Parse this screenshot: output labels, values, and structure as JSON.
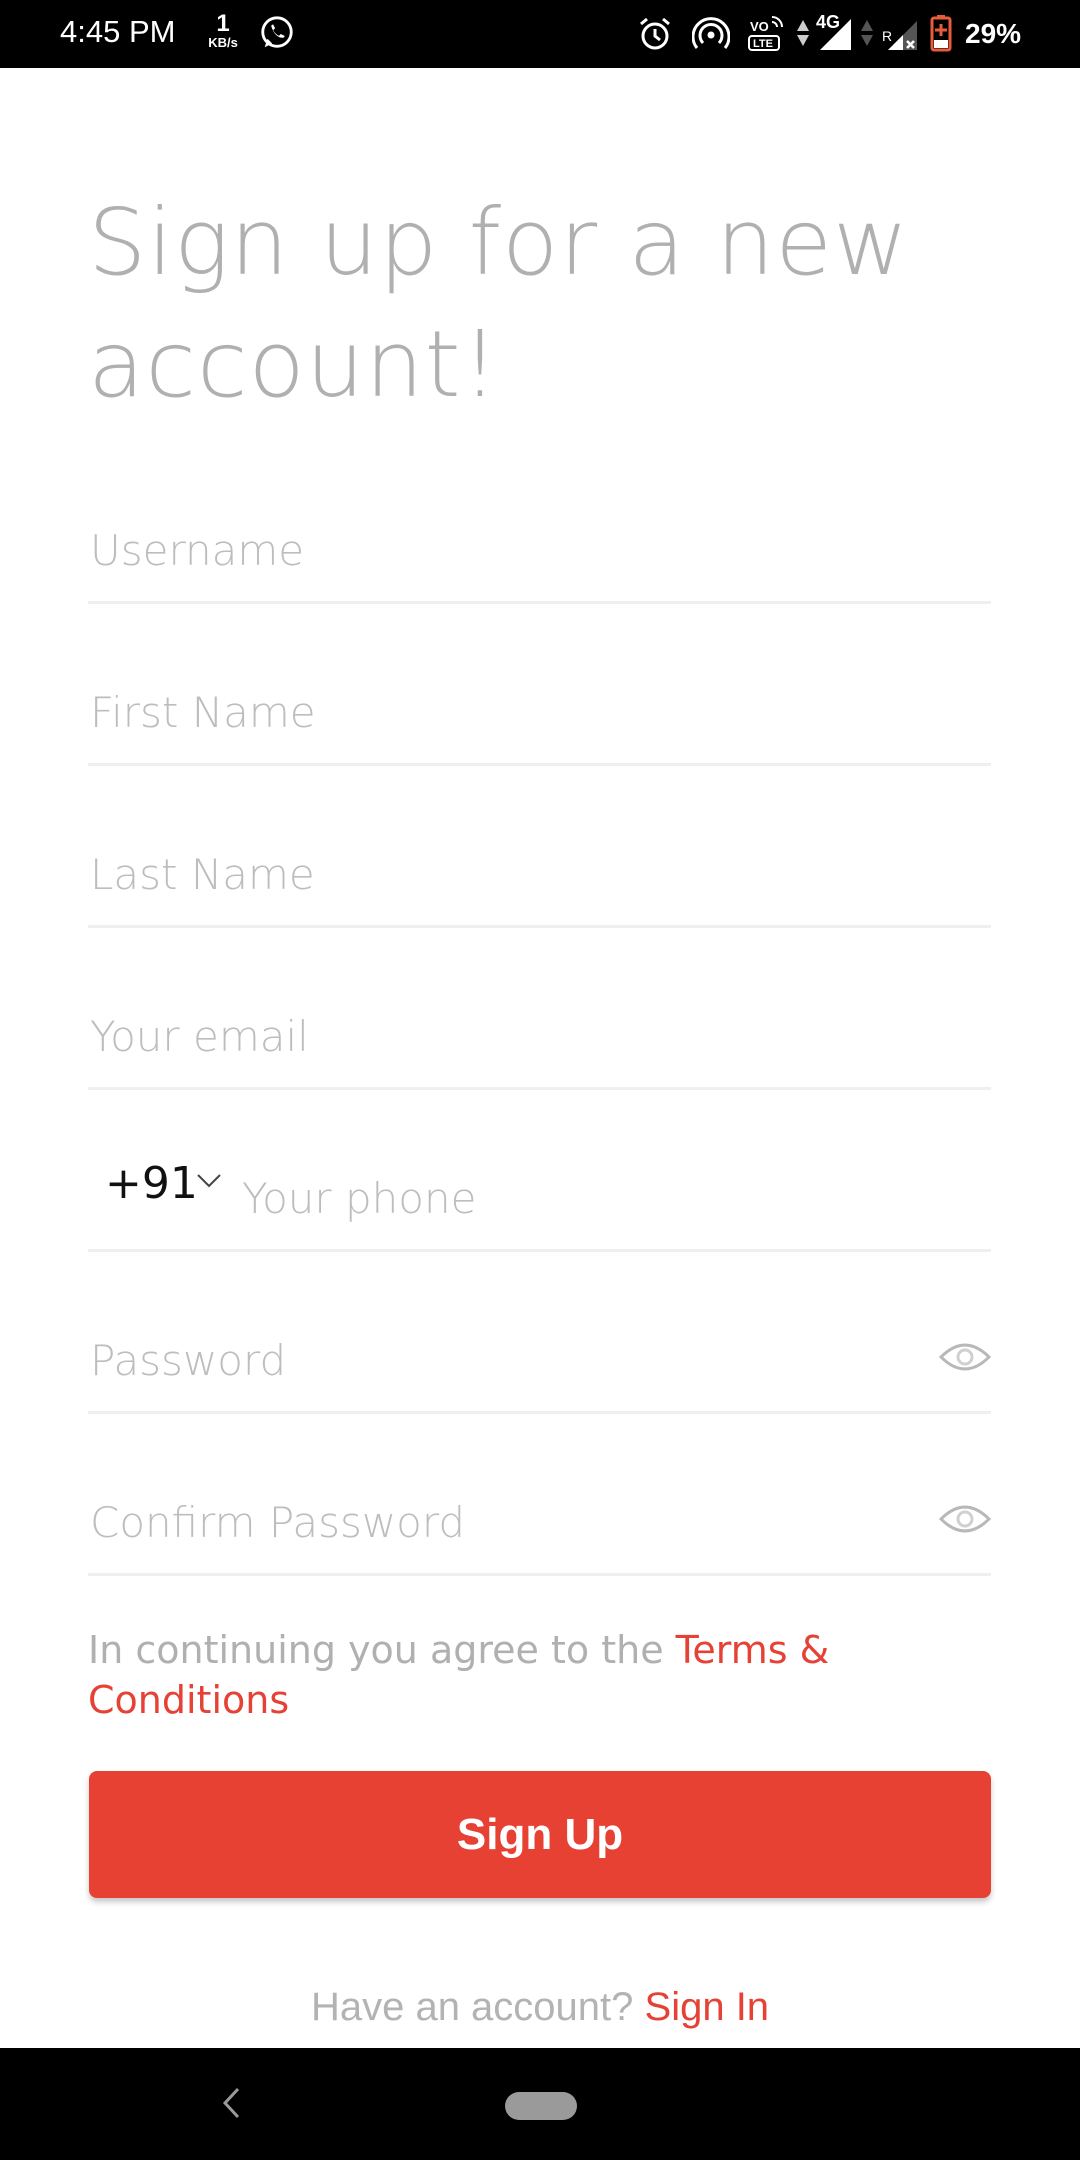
{
  "status_bar": {
    "time": "4:45 PM",
    "net_speed_value": "1",
    "net_speed_unit": "KB/s",
    "network_type": "4G",
    "roaming_label": "R",
    "volte_label": "VO",
    "lte_label": "LTE",
    "battery_percent": "29%",
    "icons": [
      "whatsapp-icon",
      "alarm-icon",
      "hotspot-icon",
      "volte-icon",
      "data-arrows-icon",
      "signal-icon",
      "roaming-signal-icon",
      "battery-icon"
    ]
  },
  "page": {
    "title": "Sign up for a new account!"
  },
  "form": {
    "username_placeholder": "Username",
    "first_name_placeholder": "First Name",
    "last_name_placeholder": "Last Name",
    "email_placeholder": "Your email",
    "country_code": "+91",
    "phone_placeholder": "Your phone",
    "password_placeholder": "Password",
    "confirm_password_placeholder": "Confirm Password"
  },
  "terms": {
    "prefix": "In continuing you agree to the ",
    "link_text": "Terms & Conditions"
  },
  "actions": {
    "signup_label": "Sign Up",
    "have_account_text": "Have an account? ",
    "signin_label": "Sign In"
  },
  "colors": {
    "accent": "#e74134",
    "placeholder": "#bdbdbd",
    "title": "#b0b0b0"
  }
}
